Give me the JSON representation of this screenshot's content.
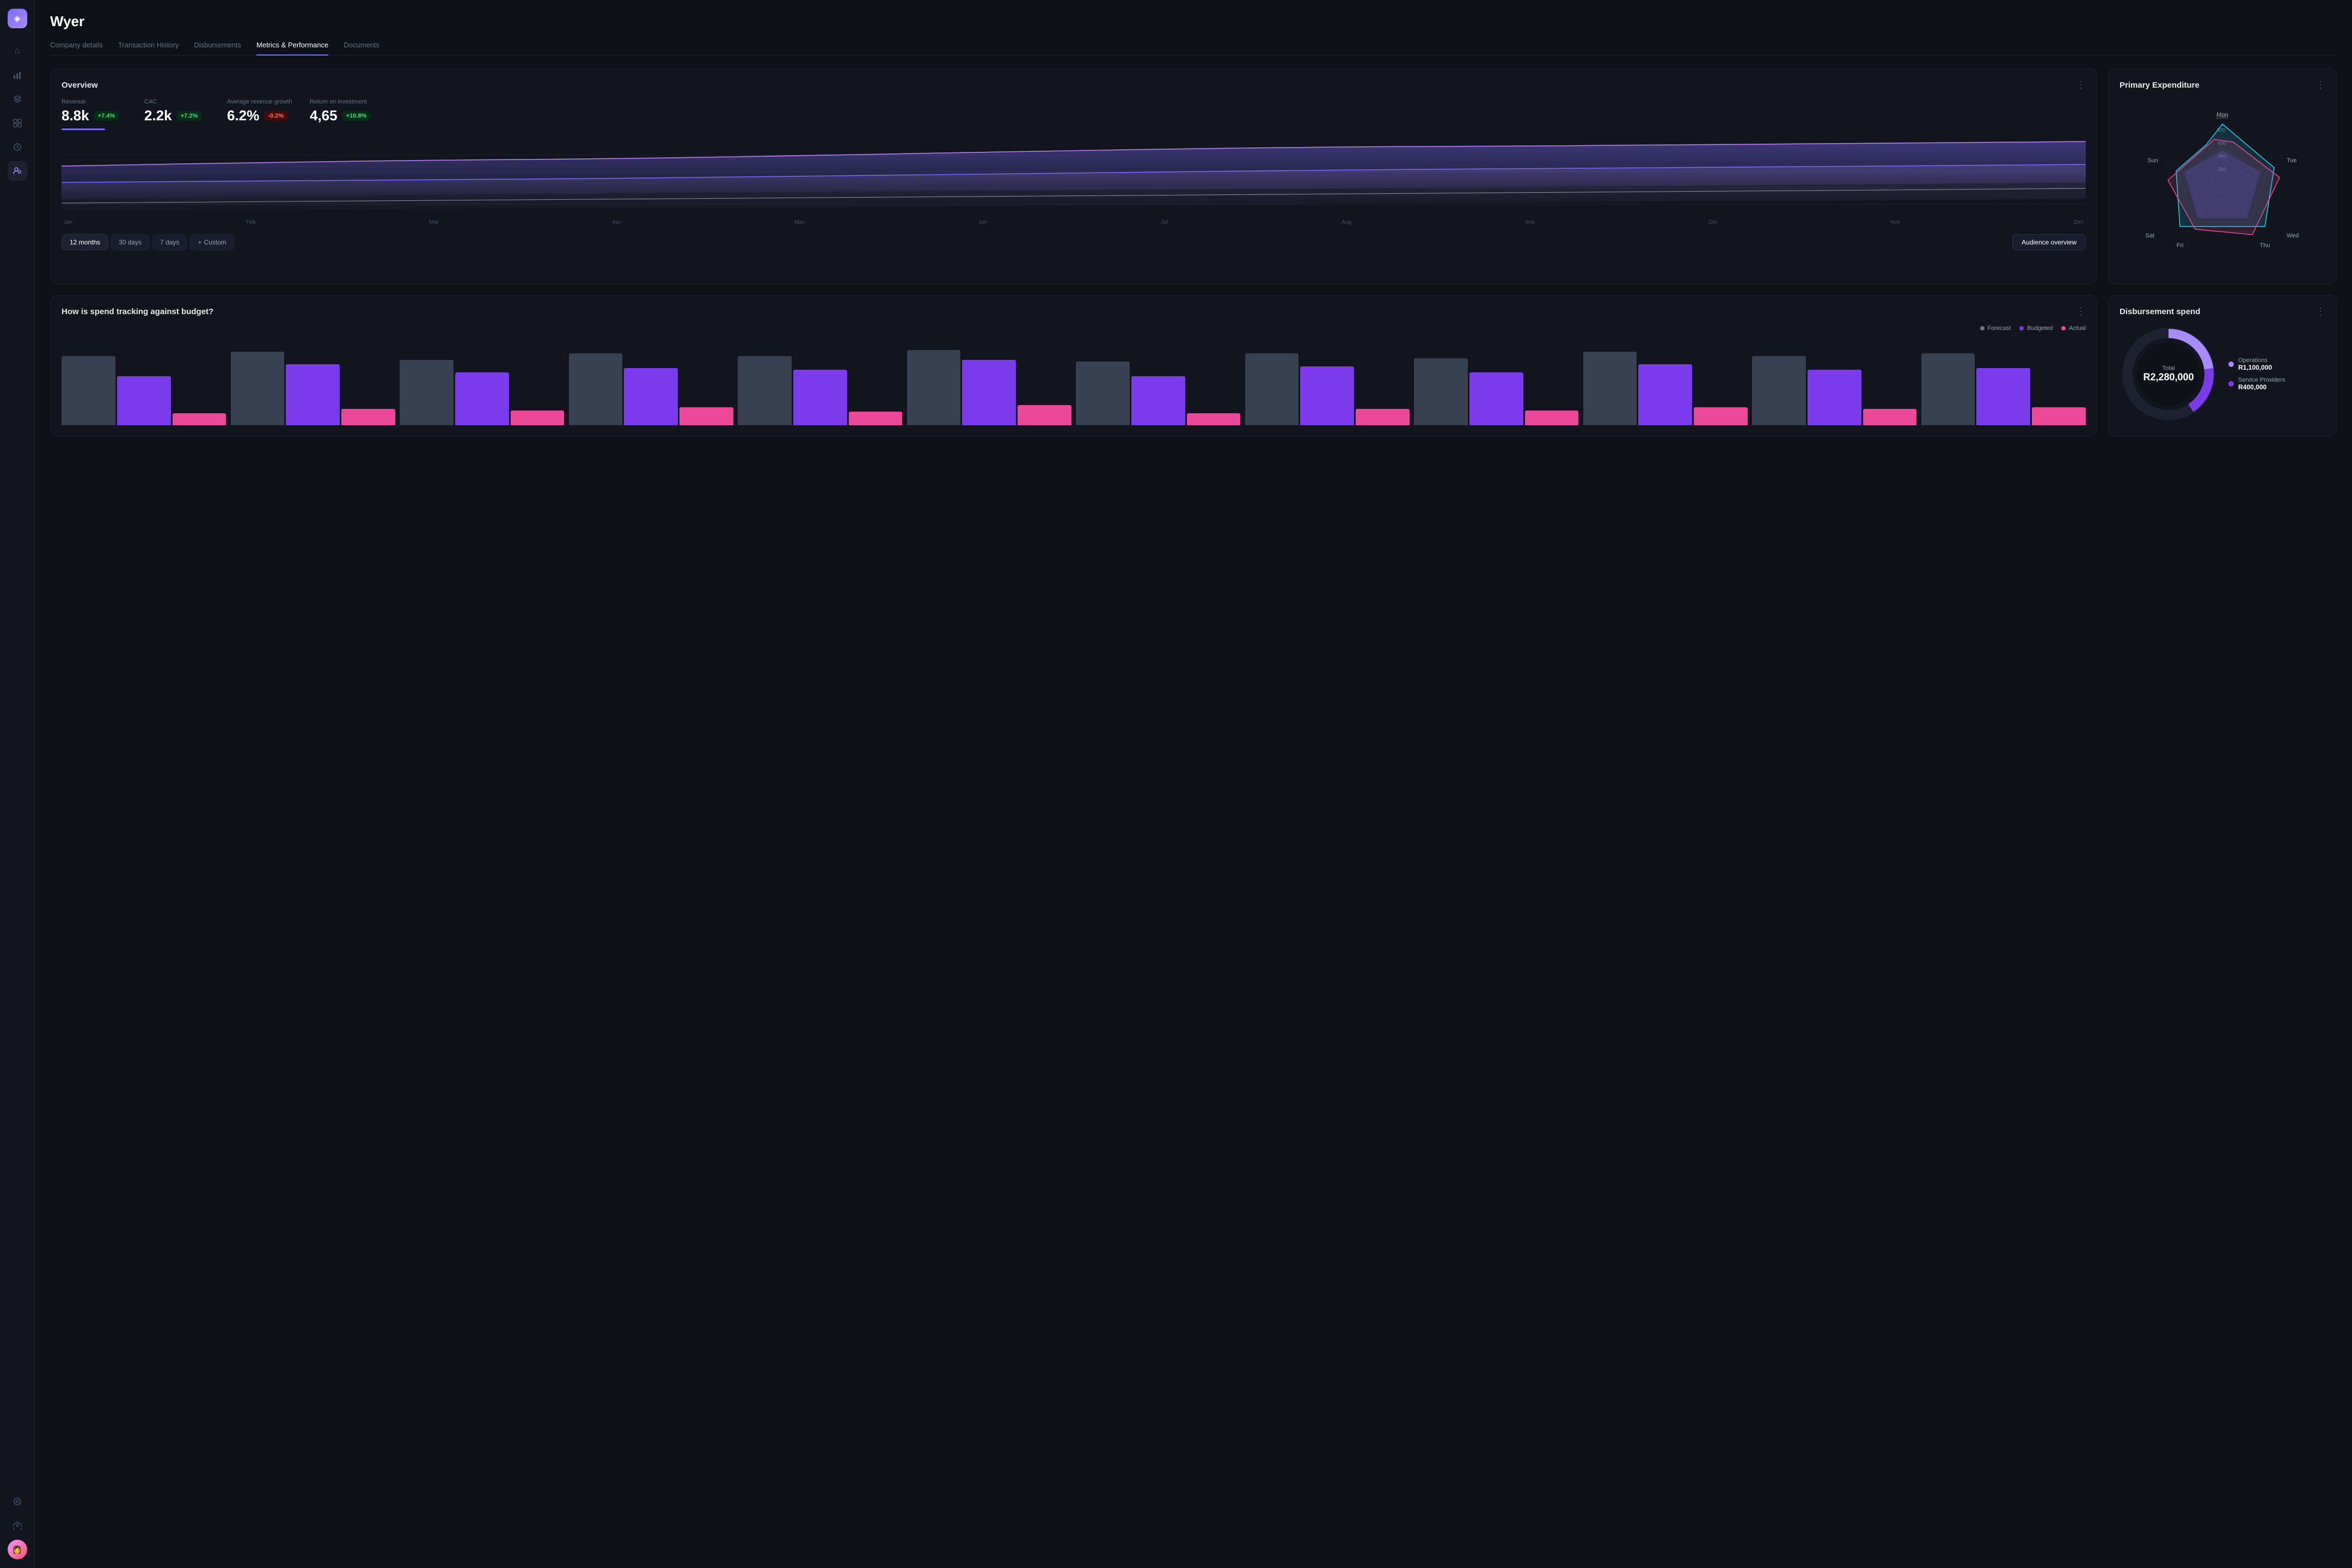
{
  "app": {
    "logo": "◈",
    "title": "Wyer"
  },
  "sidebar": {
    "icons": [
      {
        "name": "home-icon",
        "symbol": "⌂",
        "active": false
      },
      {
        "name": "chart-icon",
        "symbol": "▦",
        "active": false
      },
      {
        "name": "layers-icon",
        "symbol": "◫",
        "active": false
      },
      {
        "name": "box-icon",
        "symbol": "⬡",
        "active": false
      },
      {
        "name": "clock-icon",
        "symbol": "◷",
        "active": false
      },
      {
        "name": "users-icon",
        "symbol": "👤",
        "active": true
      }
    ],
    "bottomIcons": [
      {
        "name": "settings-alt-icon",
        "symbol": "⊙"
      },
      {
        "name": "gear-icon",
        "symbol": "⚙"
      }
    ]
  },
  "tabs": [
    {
      "label": "Company details",
      "active": false
    },
    {
      "label": "Transaction History",
      "active": false
    },
    {
      "label": "Disbursements",
      "active": false
    },
    {
      "label": "Metrics & Performance",
      "active": true
    },
    {
      "label": "Documents",
      "active": false
    }
  ],
  "overview": {
    "title": "Overview",
    "metrics": [
      {
        "label": "Revenue",
        "value": "8.8k",
        "badge": "+7.4%",
        "type": "green"
      },
      {
        "label": "CAC",
        "value": "2.2k",
        "badge": "+7.2%",
        "type": "green"
      },
      {
        "label": "Average revenue growth",
        "value": "6.2%",
        "badge": "-0.2%",
        "type": "red"
      },
      {
        "label": "Return on investment",
        "value": "4,65",
        "badge": "+10.8%",
        "type": "green"
      }
    ],
    "xAxisLabels": [
      "Jan",
      "Feb",
      "Mar",
      "Apr",
      "May",
      "Jun",
      "Jul",
      "Aug",
      "Sep",
      "Oct",
      "Nov",
      "Dec"
    ],
    "timeButtons": [
      {
        "label": "12 months",
        "active": true
      },
      {
        "label": "30 days",
        "active": false
      },
      {
        "label": "7 days",
        "active": false
      },
      {
        "label": "Custom",
        "active": false,
        "isCustom": true
      }
    ],
    "audienceBtn": "Audience overview"
  },
  "primaryExpenditure": {
    "title": "Primary Expenditure",
    "radarLabels": [
      {
        "label": "Mon",
        "x": "50%",
        "y": "2%"
      },
      {
        "label": "Tue",
        "x": "95%",
        "y": "28%"
      },
      {
        "label": "Wed",
        "x": "95%",
        "y": "70%"
      },
      {
        "label": "Thu",
        "x": "78%",
        "y": "95%"
      },
      {
        "label": "Fri",
        "x": "28%",
        "y": "95%"
      },
      {
        "label": "Sat",
        "x": "4%",
        "y": "70%"
      },
      {
        "label": "Sun",
        "x": "4%",
        "y": "28%"
      }
    ],
    "gridValues": [
      "200",
      "400",
      "600",
      "800",
      "1,000"
    ]
  },
  "spendTracking": {
    "title": "How is spend tracking against budget?",
    "legend": [
      {
        "label": "Forecast",
        "color": "#6b7280"
      },
      {
        "label": "Budgeted",
        "color": "#7c3aed"
      },
      {
        "label": "Actual",
        "color": "#2563eb"
      }
    ],
    "bars": [
      {
        "forecast": 85,
        "budgeted": 60,
        "actual": 15
      },
      {
        "forecast": 90,
        "budgeted": 75,
        "actual": 20
      },
      {
        "forecast": 80,
        "budgeted": 65,
        "actual": 18
      },
      {
        "forecast": 88,
        "budgeted": 70,
        "actual": 22
      },
      {
        "forecast": 85,
        "budgeted": 68,
        "actual": 17
      },
      {
        "forecast": 92,
        "budgeted": 80,
        "actual": 25
      },
      {
        "forecast": 78,
        "budgeted": 60,
        "actual": 15
      },
      {
        "forecast": 88,
        "budgeted": 72,
        "actual": 20
      },
      {
        "forecast": 82,
        "budgeted": 65,
        "actual": 18
      },
      {
        "forecast": 90,
        "budgeted": 75,
        "actual": 22
      },
      {
        "forecast": 85,
        "budgeted": 68,
        "actual": 20
      },
      {
        "forecast": 88,
        "budgeted": 70,
        "actual": 22
      }
    ]
  },
  "disbursementSpend": {
    "title": "Disbursement spend",
    "total_label": "Total",
    "total_value": "R2,280,000",
    "items": [
      {
        "label": "Operations",
        "value": "R1,100,000",
        "color": "#a78bfa"
      },
      {
        "label": "Service Providers",
        "value": "R400,000",
        "color": "#7c3aed"
      }
    ]
  }
}
